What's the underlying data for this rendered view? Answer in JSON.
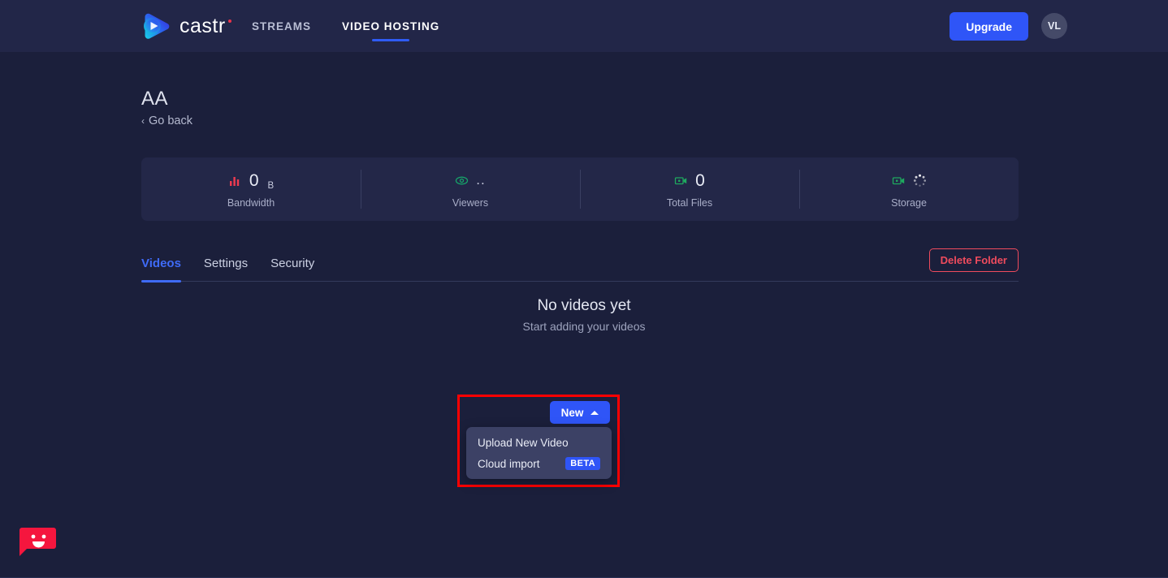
{
  "header": {
    "logo_text": "castr",
    "logo_icon": "castr-play-logo",
    "nav": [
      {
        "label": "STREAMS",
        "active": false
      },
      {
        "label": "VIDEO HOSTING",
        "active": true
      }
    ],
    "upgrade_label": "Upgrade",
    "avatar_initials": "VL"
  },
  "page": {
    "title": "AA",
    "go_back_label": "Go back",
    "go_back_chevron": "‹"
  },
  "stats": [
    {
      "icon": "bar-chart-icon",
      "value": "0",
      "unit": "B",
      "label": "Bandwidth",
      "color": "#ef3b50"
    },
    {
      "icon": "eye-icon",
      "value": "..",
      "unit": "",
      "label": "Viewers",
      "color": "#16a46a"
    },
    {
      "icon": "video-camera-icon",
      "value": "0",
      "unit": "",
      "label": "Total Files",
      "color": "#1fa95f"
    },
    {
      "icon": "video-camera-icon",
      "value": "",
      "unit": "",
      "label": "Storage",
      "color": "#1fa95f",
      "loading": true
    }
  ],
  "tabs": [
    {
      "label": "Videos",
      "active": true
    },
    {
      "label": "Settings",
      "active": false
    },
    {
      "label": "Security",
      "active": false
    }
  ],
  "delete_folder_label": "Delete Folder",
  "empty_state": {
    "title": "No videos yet",
    "subtitle": "Start adding your videos"
  },
  "new_menu": {
    "button_label": "New",
    "button_caret": "caret-up-icon",
    "items": [
      {
        "label": "Upload New Video",
        "badge": ""
      },
      {
        "label": "Cloud import",
        "badge": "BETA"
      }
    ]
  },
  "chat": {
    "icon": "chat-smiley-icon"
  },
  "colors": {
    "page_bg": "#1b1f3b",
    "header_bg": "#222648",
    "card_bg": "#232748",
    "accent_blue": "#2f55f7",
    "tab_active": "#3f6bf8",
    "danger_red": "#ef4b5d",
    "highlight_red": "#ff0000",
    "dropdown_bg": "#3c4165",
    "chat_red": "#f5163e"
  }
}
